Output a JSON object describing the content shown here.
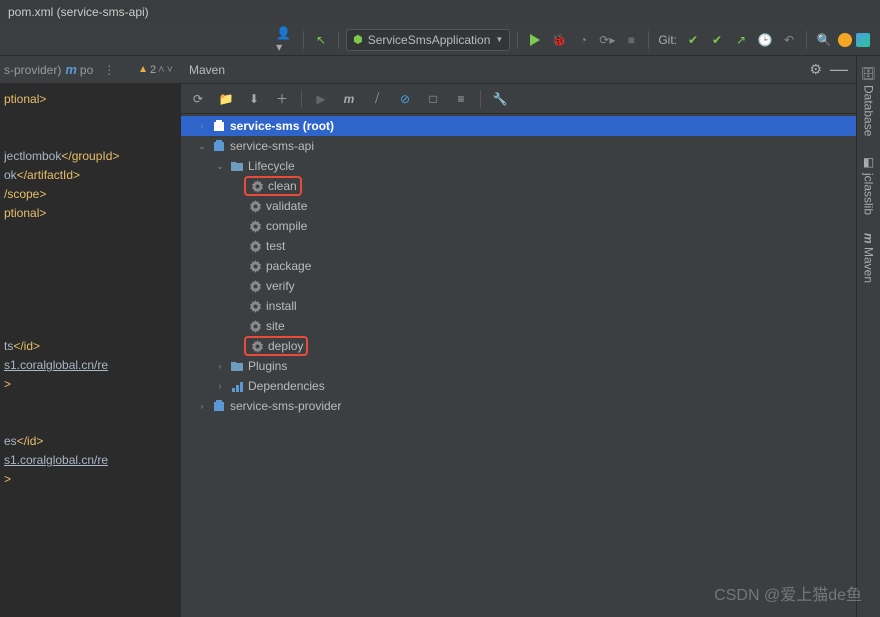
{
  "window": {
    "title": "pom.xml (service-sms-api)"
  },
  "toolbar": {
    "runConfig": "ServiceSmsApplication",
    "gitLabel": "Git:"
  },
  "editorTabs": [
    {
      "label": "s-provider)"
    },
    {
      "label": "po"
    }
  ],
  "warnings": {
    "tri": "▲",
    "count": "2"
  },
  "editor": {
    "lines": [
      {
        "t": "opt",
        "text": "ptional>"
      },
      {
        "t": "blank"
      },
      {
        "t": "blank"
      },
      {
        "t": "tag",
        "pre": "jectlombok",
        "tag": "</groupId>"
      },
      {
        "t": "tag",
        "pre": "ok",
        "tag": "</artifactId>"
      },
      {
        "t": "tag",
        "pre": "",
        "tag": "/scope>"
      },
      {
        "t": "opt",
        "text": "ptional>"
      },
      {
        "t": "blank"
      },
      {
        "t": "blank"
      },
      {
        "t": "blank"
      },
      {
        "t": "blank"
      },
      {
        "t": "blank"
      },
      {
        "t": "blank"
      },
      {
        "t": "tag",
        "pre": "ts",
        "tag": "</id>"
      },
      {
        "t": "url",
        "text": "s1.coralglobal.cn/re"
      },
      {
        "t": "tag",
        "pre": "",
        "tag": ">"
      },
      {
        "t": "blank"
      },
      {
        "t": "blank"
      },
      {
        "t": "tag",
        "pre": "es",
        "tag": "</id>"
      },
      {
        "t": "url",
        "text": "s1.coralglobal.cn/re"
      },
      {
        "t": "tag",
        "pre": "",
        "tag": ">"
      }
    ]
  },
  "maven": {
    "title": "Maven",
    "nodes": [
      {
        "level": 0,
        "expander": "›",
        "icon": "module",
        "label": "service-sms (root)",
        "selected": true,
        "bold": true
      },
      {
        "level": 0,
        "expander": "⌄",
        "icon": "module",
        "label": "service-sms-api"
      },
      {
        "level": 1,
        "expander": "⌄",
        "icon": "folder",
        "label": "Lifecycle"
      },
      {
        "level": 2,
        "expander": "",
        "icon": "gear",
        "label": "clean",
        "hl": true
      },
      {
        "level": 2,
        "expander": "",
        "icon": "gear",
        "label": "validate"
      },
      {
        "level": 2,
        "expander": "",
        "icon": "gear",
        "label": "compile"
      },
      {
        "level": 2,
        "expander": "",
        "icon": "gear",
        "label": "test"
      },
      {
        "level": 2,
        "expander": "",
        "icon": "gear",
        "label": "package"
      },
      {
        "level": 2,
        "expander": "",
        "icon": "gear",
        "label": "verify"
      },
      {
        "level": 2,
        "expander": "",
        "icon": "gear",
        "label": "install"
      },
      {
        "level": 2,
        "expander": "",
        "icon": "gear",
        "label": "site"
      },
      {
        "level": 2,
        "expander": "",
        "icon": "gear",
        "label": "deploy",
        "hl": true
      },
      {
        "level": 1,
        "expander": "›",
        "icon": "folder",
        "label": "Plugins"
      },
      {
        "level": 1,
        "expander": "›",
        "icon": "bars",
        "label": "Dependencies"
      },
      {
        "level": 0,
        "expander": "›",
        "icon": "module",
        "label": "service-sms-provider"
      }
    ]
  },
  "sidebarRight": {
    "tabs": [
      "Database",
      "jclasslib",
      "Maven"
    ]
  },
  "watermark": "CSDN @爱上猫de鱼"
}
